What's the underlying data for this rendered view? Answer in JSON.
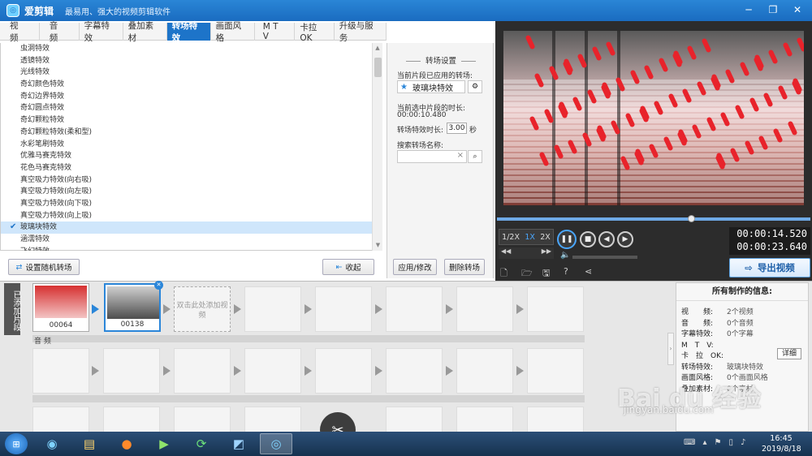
{
  "app": {
    "name": "爱剪辑",
    "slogan": "最易用、强大的视频剪辑软件"
  },
  "window_controls": [
    "─",
    "❐",
    "✕"
  ],
  "tabs": [
    {
      "label": "视 频",
      "active": false
    },
    {
      "label": "音 频",
      "active": false
    },
    {
      "label": "字幕特效",
      "active": false
    },
    {
      "label": "叠加素材",
      "active": false
    },
    {
      "label": "转场特效",
      "active": true
    },
    {
      "label": "画面风格",
      "active": false
    },
    {
      "label": "M T V",
      "active": false
    },
    {
      "label": "卡拉OK",
      "active": false
    },
    {
      "label": "升级与服务",
      "active": false
    }
  ],
  "effects": {
    "items": [
      "虫洞特效",
      "透镜特效",
      "光线特效",
      "奇幻颜色特效",
      "奇幻边界特效",
      "奇幻圆点特效",
      "奇幻颗粒特效",
      "奇幻颗粒特效(柔和型)",
      "水彩笔刷特效",
      "优雅马赛克特效",
      "花色马赛克特效",
      "真空吸力特效(向右吸)",
      "真空吸力特效(向左吸)",
      "真空吸力特效(向下吸)",
      "真空吸力特效(向上吸)",
      "玻璃块特效",
      "涵濡特效",
      "飞幻特效"
    ],
    "selected_index": 15,
    "random_button": "设置随机转场",
    "collapse_button": "收起"
  },
  "settings": {
    "title": "转场设置",
    "applied_label": "当前片段已应用的转场:",
    "applied_value": "玻璃块特效",
    "clip_duration_label": "当前选中片段的时长:",
    "clip_duration_value": "00:00:10.480",
    "effect_duration_label": "转场特效时长:",
    "effect_duration_value": "3.00",
    "effect_duration_unit": "秒",
    "search_label": "搜索转场名称:",
    "search_clear": "×",
    "apply_button": "应用/修改",
    "delete_button": "删除转场"
  },
  "player": {
    "speeds": [
      "1/2X",
      "1X",
      "2X"
    ],
    "selected_speed": "1X",
    "current_time": "00:00:14.520",
    "total_time": "00:00:23.640",
    "progress": 0.61,
    "export_button": "导出视频"
  },
  "timeline": {
    "side_tab": "已添加片段",
    "clips": [
      {
        "caption": "00064"
      },
      {
        "caption": "00138"
      }
    ],
    "add_hint": "双击此处添加视频",
    "audio_label": "音 频"
  },
  "info": {
    "title": "所有制作的信息:",
    "rows": [
      {
        "key": "视　　频:",
        "value": "2个视频"
      },
      {
        "key": "音　　频:",
        "value": "0个音频"
      },
      {
        "key": "字幕特效:",
        "value": "0个字幕"
      },
      {
        "key": "M　T　V:",
        "value": ""
      },
      {
        "key": "卡　拉　OK:",
        "value": ""
      },
      {
        "key": "转场特效:",
        "value": "玻璃块特效"
      },
      {
        "key": "画面风格:",
        "value": "0个画面风格"
      },
      {
        "key": "叠加素材:",
        "value": "0个素材"
      }
    ],
    "detail_button": "详细"
  },
  "taskbar": {
    "time": "16:45",
    "date": "2019/8/18"
  },
  "watermark": {
    "brand": "Bai du 经验",
    "url": "jingyan.baidu.com"
  }
}
